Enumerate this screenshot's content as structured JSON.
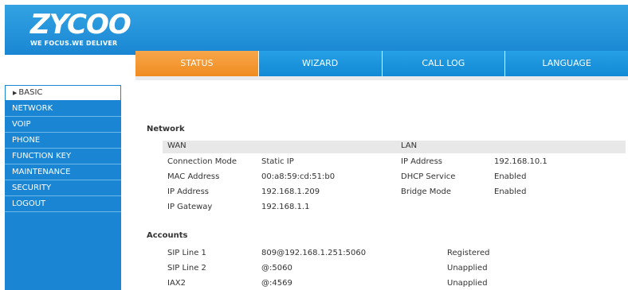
{
  "logo": {
    "mark": "ZYCOO",
    "tagline": "WE FOCUS.WE DELIVER"
  },
  "tabs": [
    {
      "label": "STATUS",
      "active": true
    },
    {
      "label": "WIZARD",
      "active": false
    },
    {
      "label": "CALL LOG",
      "active": false
    },
    {
      "label": "LANGUAGE",
      "active": false
    }
  ],
  "sidebar": {
    "items": [
      {
        "label": "BASIC",
        "active": true
      },
      {
        "label": "NETWORK"
      },
      {
        "label": "VOIP"
      },
      {
        "label": "PHONE"
      },
      {
        "label": "FUNCTION KEY"
      },
      {
        "label": "MAINTENANCE"
      },
      {
        "label": "SECURITY"
      },
      {
        "label": "LOGOUT"
      }
    ]
  },
  "network": {
    "title": "Network",
    "wan_label": "WAN",
    "lan_label": "LAN",
    "wan": [
      {
        "label": "Connection Mode",
        "value": "Static IP"
      },
      {
        "label": "MAC Address",
        "value": "00:a8:59:cd:51:b0"
      },
      {
        "label": "IP Address",
        "value": "192.168.1.209"
      },
      {
        "label": "IP Gateway",
        "value": "192.168.1.1"
      }
    ],
    "lan": [
      {
        "label": "IP Address",
        "value": "192.168.10.1"
      },
      {
        "label": "DHCP Service",
        "value": "Enabled"
      },
      {
        "label": "Bridge Mode",
        "value": "Enabled"
      }
    ]
  },
  "accounts": {
    "title": "Accounts",
    "rows": [
      {
        "line": "SIP Line 1",
        "address": "809@192.168.1.251:5060",
        "status": "Registered"
      },
      {
        "line": "SIP Line 2",
        "address": "@:5060",
        "status": "Unapplied"
      },
      {
        "line": "IAX2",
        "address": "@:4569",
        "status": "Unapplied"
      }
    ]
  },
  "colors": {
    "header_blue": "#1a86d3",
    "active_tab": "#f08c20"
  }
}
